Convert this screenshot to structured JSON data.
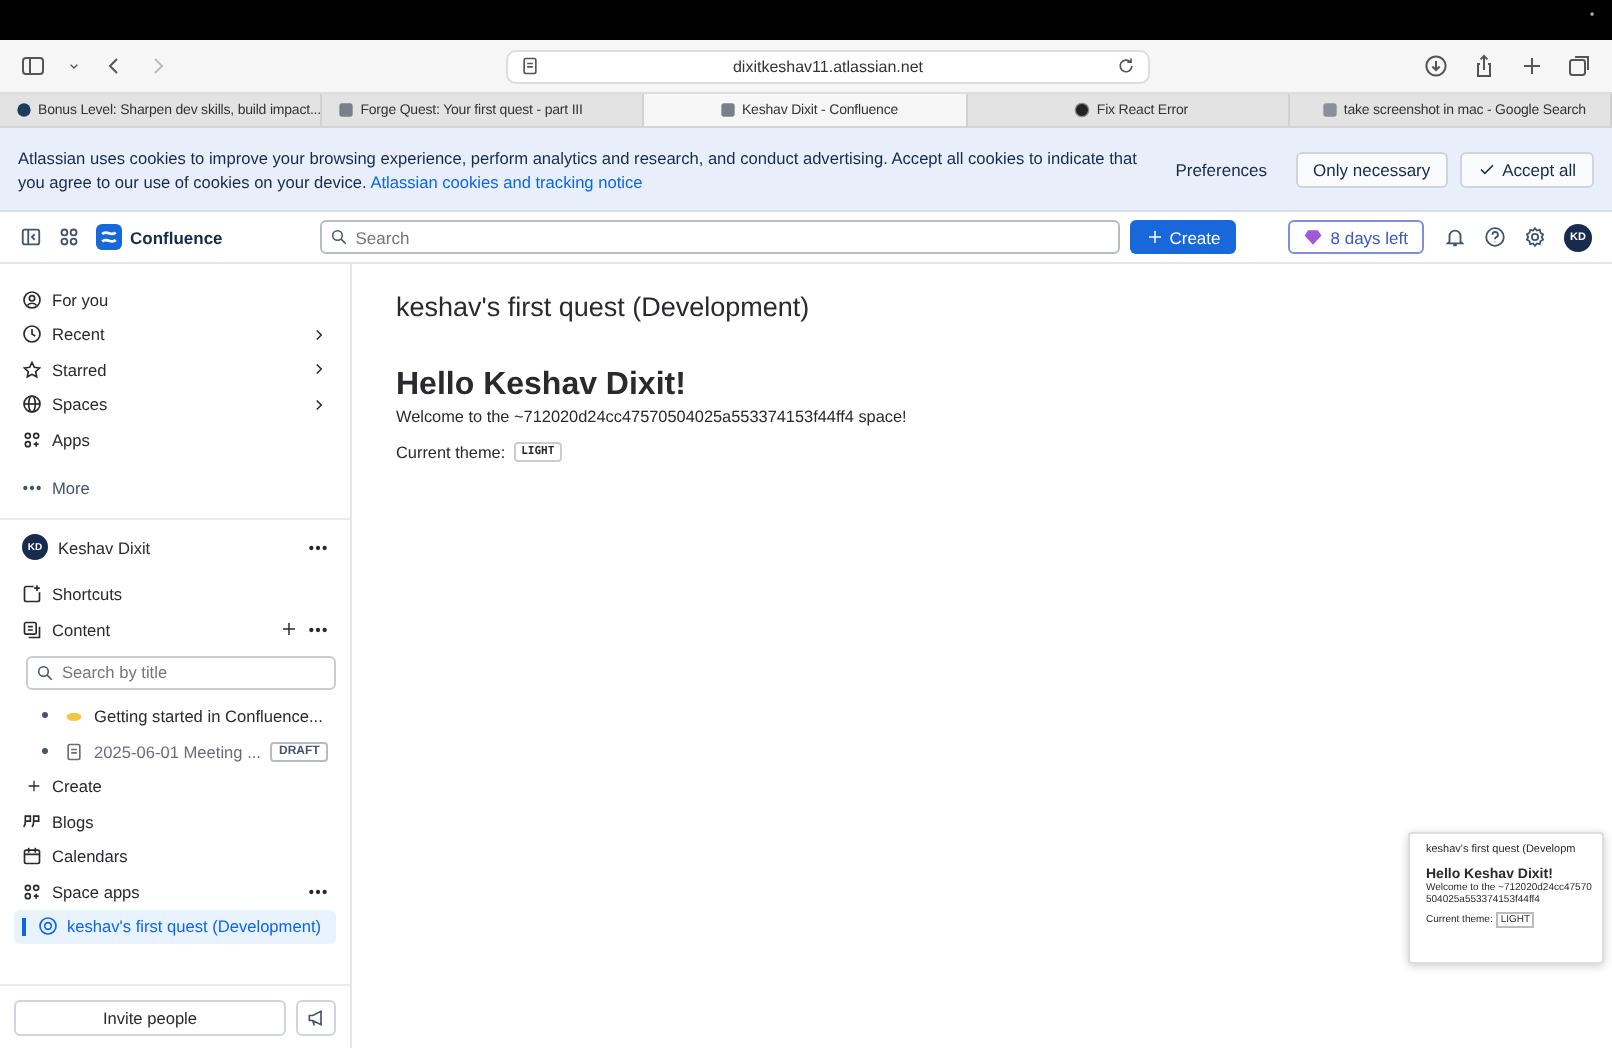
{
  "browser": {
    "url": "dixitkeshav11.atlassian.net",
    "tabs": [
      {
        "label": "Bonus Level: Sharpen dev skills, build impact...",
        "selected": false
      },
      {
        "label": "Forge Quest: Your first quest - part III",
        "selected": false
      },
      {
        "label": "Keshav Dixit - Confluence",
        "selected": true
      },
      {
        "label": "Fix React Error",
        "selected": false
      },
      {
        "label": "take screenshot in mac - Google Search",
        "selected": false
      }
    ]
  },
  "cookie_banner": {
    "text": "Atlassian uses cookies to improve your browsing experience, perform analytics and research, and conduct advertising. Accept all cookies to indicate that you agree to our use of cookies on your device.",
    "link": "Atlassian cookies and tracking notice",
    "buttons": [
      {
        "label": "Preferences",
        "kind": "plain"
      },
      {
        "label": "Only necessary",
        "kind": "outline"
      },
      {
        "label": "Accept all",
        "kind": "check"
      }
    ]
  },
  "header": {
    "app_name": "Confluence",
    "search": {
      "placeholder": "Search"
    },
    "create_button": "Create",
    "trial_badge": "8 days left",
    "avatar": "KD"
  },
  "sidebar": {
    "nav": [
      {
        "label": "For you",
        "expandable": false
      },
      {
        "label": "Recent",
        "expandable": true
      },
      {
        "label": "Starred",
        "expandable": true
      },
      {
        "label": "Spaces",
        "expandable": true
      },
      {
        "label": "Apps",
        "expandable": false
      }
    ],
    "more": "More",
    "space": {
      "avatar": "KD",
      "name": "Keshav Dixit"
    },
    "shortcuts": "Shortcuts",
    "content": {
      "label": "Content",
      "search": {
        "placeholder": "Search by title"
      },
      "pages": [
        {
          "kind": "page",
          "label": "Getting started in Confluence..."
        },
        {
          "kind": "draft",
          "label": "2025-06-01 Meeting ...",
          "badge": "DRAFT"
        }
      ],
      "create": "Create"
    },
    "links": [
      {
        "label": "Blogs",
        "selected": false,
        "has_menu": false
      },
      {
        "label": "Calendars",
        "selected": false,
        "has_menu": false
      },
      {
        "label": "Space apps",
        "selected": false,
        "has_menu": true
      },
      {
        "label": "keshav's first quest (Development)",
        "selected": true,
        "has_menu": false
      }
    ],
    "invite_button": "Invite people"
  },
  "page": {
    "title": "keshav's first quest (Development)",
    "heading": "Hello Keshav Dixit!",
    "welcome": "Welcome to the ~712020d24cc47570504025a553374153f44ff4 space!",
    "theme_label": "Current theme:",
    "theme_value": "LIGHT"
  },
  "preview": {
    "title": "keshav's first quest (Developm",
    "heading": "Hello Keshav Dixit!",
    "welcome": "Welcome to the ~712020d24cc47570504025a553374153f44ff4",
    "theme_label": "Current theme:",
    "theme_value": "LIGHT"
  }
}
